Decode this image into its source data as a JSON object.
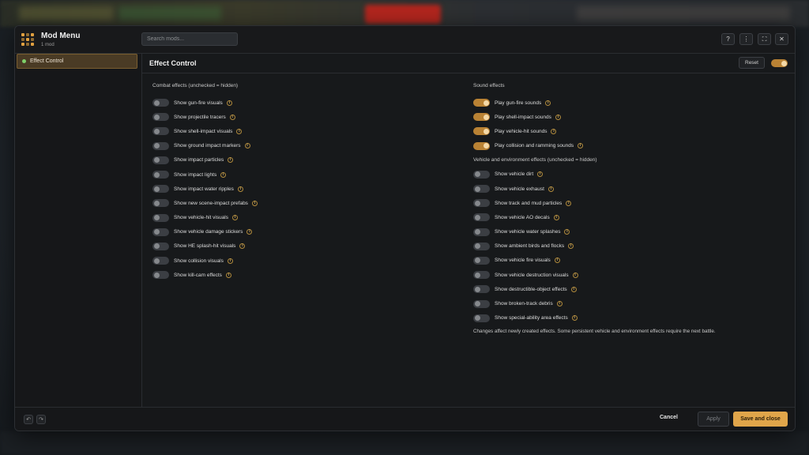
{
  "app": {
    "title": "Mod Menu",
    "subtitle": "1 mod"
  },
  "search": {
    "placeholder": "Search mods..."
  },
  "titlebar_buttons": [
    {
      "icon": "help-icon",
      "glyph": "?"
    },
    {
      "icon": "more-icon",
      "glyph": "⋮"
    },
    {
      "icon": "fullscreen-icon",
      "glyph": "⛶"
    },
    {
      "icon": "close-icon",
      "glyph": "✕"
    }
  ],
  "sidebar": {
    "items": [
      {
        "label": "Effect Control",
        "active": true
      }
    ]
  },
  "content": {
    "title": "Effect Control",
    "reset_label": "Reset",
    "master_enabled": true
  },
  "combat": {
    "title": "Combat effects (unchecked = hidden)",
    "items": [
      {
        "label": "Show gun-fire visuals",
        "on": false
      },
      {
        "label": "Show projectile tracers",
        "on": false
      },
      {
        "label": "Show shell-impact visuals",
        "on": false
      },
      {
        "label": "Show ground impact markers",
        "on": false
      },
      {
        "label": "Show impact particles",
        "on": false
      },
      {
        "label": "Show impact lights",
        "on": false
      },
      {
        "label": "Show impact water ripples",
        "on": false
      },
      {
        "label": "Show new scene-impact prefabs",
        "on": false
      },
      {
        "label": "Show vehicle-hit visuals",
        "on": false
      },
      {
        "label": "Show vehicle damage stickers",
        "on": false
      },
      {
        "label": "Show HE splash-hit visuals",
        "on": false
      },
      {
        "label": "Show collision visuals",
        "on": false
      },
      {
        "label": "Show kill-cam effects",
        "on": false
      }
    ]
  },
  "sound": {
    "title": "Sound effects",
    "items": [
      {
        "label": "Play gun-fire sounds",
        "on": true
      },
      {
        "label": "Play shell-impact sounds",
        "on": true
      },
      {
        "label": "Play vehicle-hit sounds",
        "on": true
      },
      {
        "label": "Play collision and ramming sounds",
        "on": true
      }
    ]
  },
  "vehicle": {
    "title": "Vehicle and environment effects (unchecked = hidden)",
    "items": [
      {
        "label": "Show vehicle dirt",
        "on": false
      },
      {
        "label": "Show vehicle exhaust",
        "on": false
      },
      {
        "label": "Show track and mud particles",
        "on": false
      },
      {
        "label": "Show vehicle AO decals",
        "on": false
      },
      {
        "label": "Show vehicle water splashes",
        "on": false
      },
      {
        "label": "Show ambient birds and flocks",
        "on": false
      },
      {
        "label": "Show vehicle fire visuals",
        "on": false
      },
      {
        "label": "Show vehicle destruction visuals",
        "on": false
      },
      {
        "label": "Show destructible-object effects",
        "on": false
      },
      {
        "label": "Show broken-track debris",
        "on": false
      },
      {
        "label": "Show special-ability area effects",
        "on": false
      }
    ],
    "note": "Changes affect newly created effects. Some persistent vehicle and environment effects require the next battle."
  },
  "footer": {
    "cancel": "Cancel",
    "apply": "Apply",
    "save": "Save and close",
    "undo_glyph": "↶",
    "redo_glyph": "↷"
  },
  "colors": {
    "accent": "#e0a54a",
    "toggle_on": "#b98234",
    "toggle_off": "#3b3e43"
  }
}
